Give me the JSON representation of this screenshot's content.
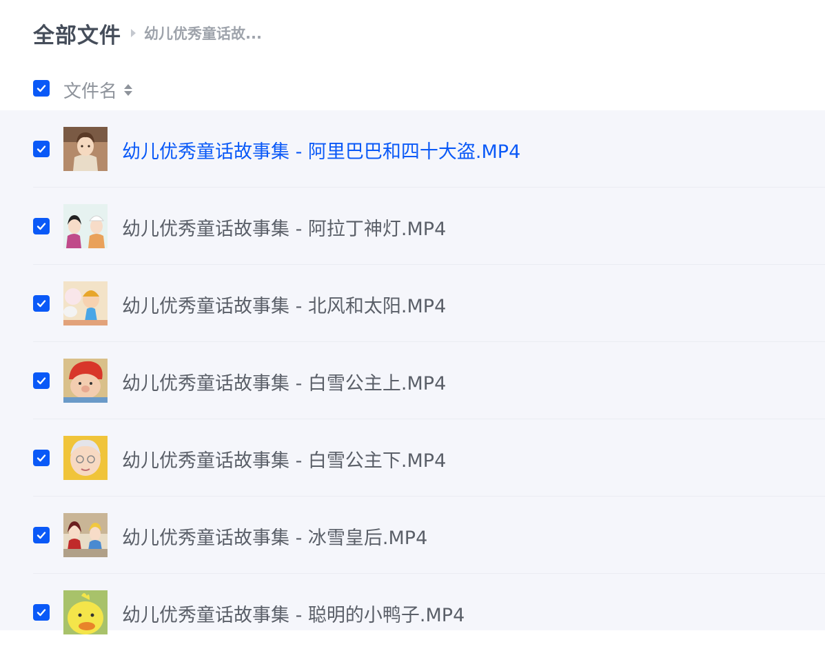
{
  "breadcrumb": {
    "root": "全部文件",
    "current": "幼儿优秀童话故..."
  },
  "list_header": {
    "select_all_checked": true,
    "column_title": "文件名",
    "sort_icon": "sort-updown-icon"
  },
  "files": [
    {
      "name": "幼儿优秀童话故事集 - 阿里巴巴和四十大盗.MP4",
      "checked": true,
      "active": true,
      "thumbnail": "video-thumbnail"
    },
    {
      "name": "幼儿优秀童话故事集 - 阿拉丁神灯.MP4",
      "checked": true,
      "active": false,
      "thumbnail": "video-thumbnail"
    },
    {
      "name": "幼儿优秀童话故事集 - 北风和太阳.MP4",
      "checked": true,
      "active": false,
      "thumbnail": "video-thumbnail"
    },
    {
      "name": "幼儿优秀童话故事集 - 白雪公主上.MP4",
      "checked": true,
      "active": false,
      "thumbnail": "video-thumbnail"
    },
    {
      "name": "幼儿优秀童话故事集 - 白雪公主下.MP4",
      "checked": true,
      "active": false,
      "thumbnail": "video-thumbnail"
    },
    {
      "name": "幼儿优秀童话故事集 - 冰雪皇后.MP4",
      "checked": true,
      "active": false,
      "thumbnail": "video-thumbnail"
    },
    {
      "name": "幼儿优秀童话故事集 - 聪明的小鸭子.MP4",
      "checked": true,
      "active": false,
      "thumbnail": "video-thumbnail"
    }
  ],
  "colors": {
    "accent": "#0a59f7",
    "list_background": "#f5f6fb",
    "text": "#5a5f68"
  }
}
